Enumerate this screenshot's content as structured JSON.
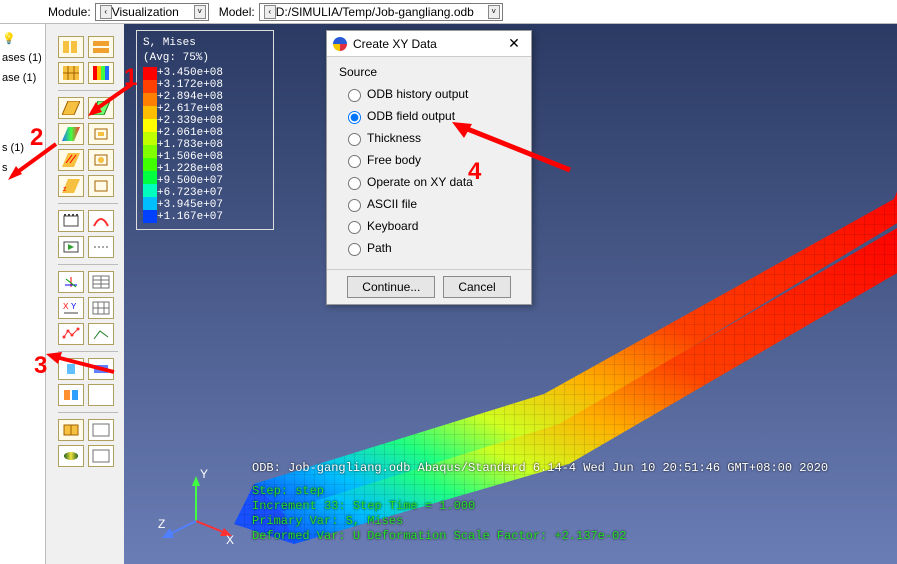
{
  "topbar": {
    "module_label": "Module:",
    "module_value": "Visualization",
    "model_label": "Model:",
    "model_value": "D:/SIMULIA/Temp/Job-gangliang.odb"
  },
  "left_tree": {
    "items": [
      "ases (1)",
      "ase (1)",
      "s (1)",
      "s"
    ]
  },
  "legend": {
    "title1": "S, Mises",
    "title2": "(Avg: 75%)",
    "values": [
      "+3.450e+08",
      "+3.172e+08",
      "+2.894e+08",
      "+2.617e+08",
      "+2.339e+08",
      "+2.061e+08",
      "+1.783e+08",
      "+1.506e+08",
      "+1.228e+08",
      "+9.500e+07",
      "+6.723e+07",
      "+3.945e+07",
      "+1.167e+07"
    ],
    "colors": [
      "#ff0000",
      "#ff4000",
      "#ff8000",
      "#ffbf00",
      "#ffff00",
      "#bfff00",
      "#80ff00",
      "#40ff00",
      "#00ff40",
      "#00ffbf",
      "#00bfff",
      "#0040ff"
    ]
  },
  "dialog": {
    "title": "Create XY Data",
    "group": "Source",
    "options": [
      "ODB history output",
      "ODB field output",
      "Thickness",
      "Free body",
      "Operate on XY data",
      "ASCII file",
      "Keyboard",
      "Path"
    ],
    "selected_index": 1,
    "continue": "Continue...",
    "cancel": "Cancel"
  },
  "info": {
    "line1": "ODB: Job-gangliang.odb    Abaqus/Standard 6.14-4    Wed Jun 10 20:51:46 GMT+08:00 2020",
    "step_a": "Step: step",
    "step_b": "Increment     33: Step Time =    1.000",
    "step_c": "Primary Var: S, Mises",
    "step_d": "Deformed Var: U   Deformation Scale Factor: +2.137e-02"
  },
  "triad": {
    "x": "X",
    "y": "Y",
    "z": "Z"
  },
  "ann": {
    "n1": "1",
    "n2": "2",
    "n3": "3",
    "n4": "4"
  }
}
